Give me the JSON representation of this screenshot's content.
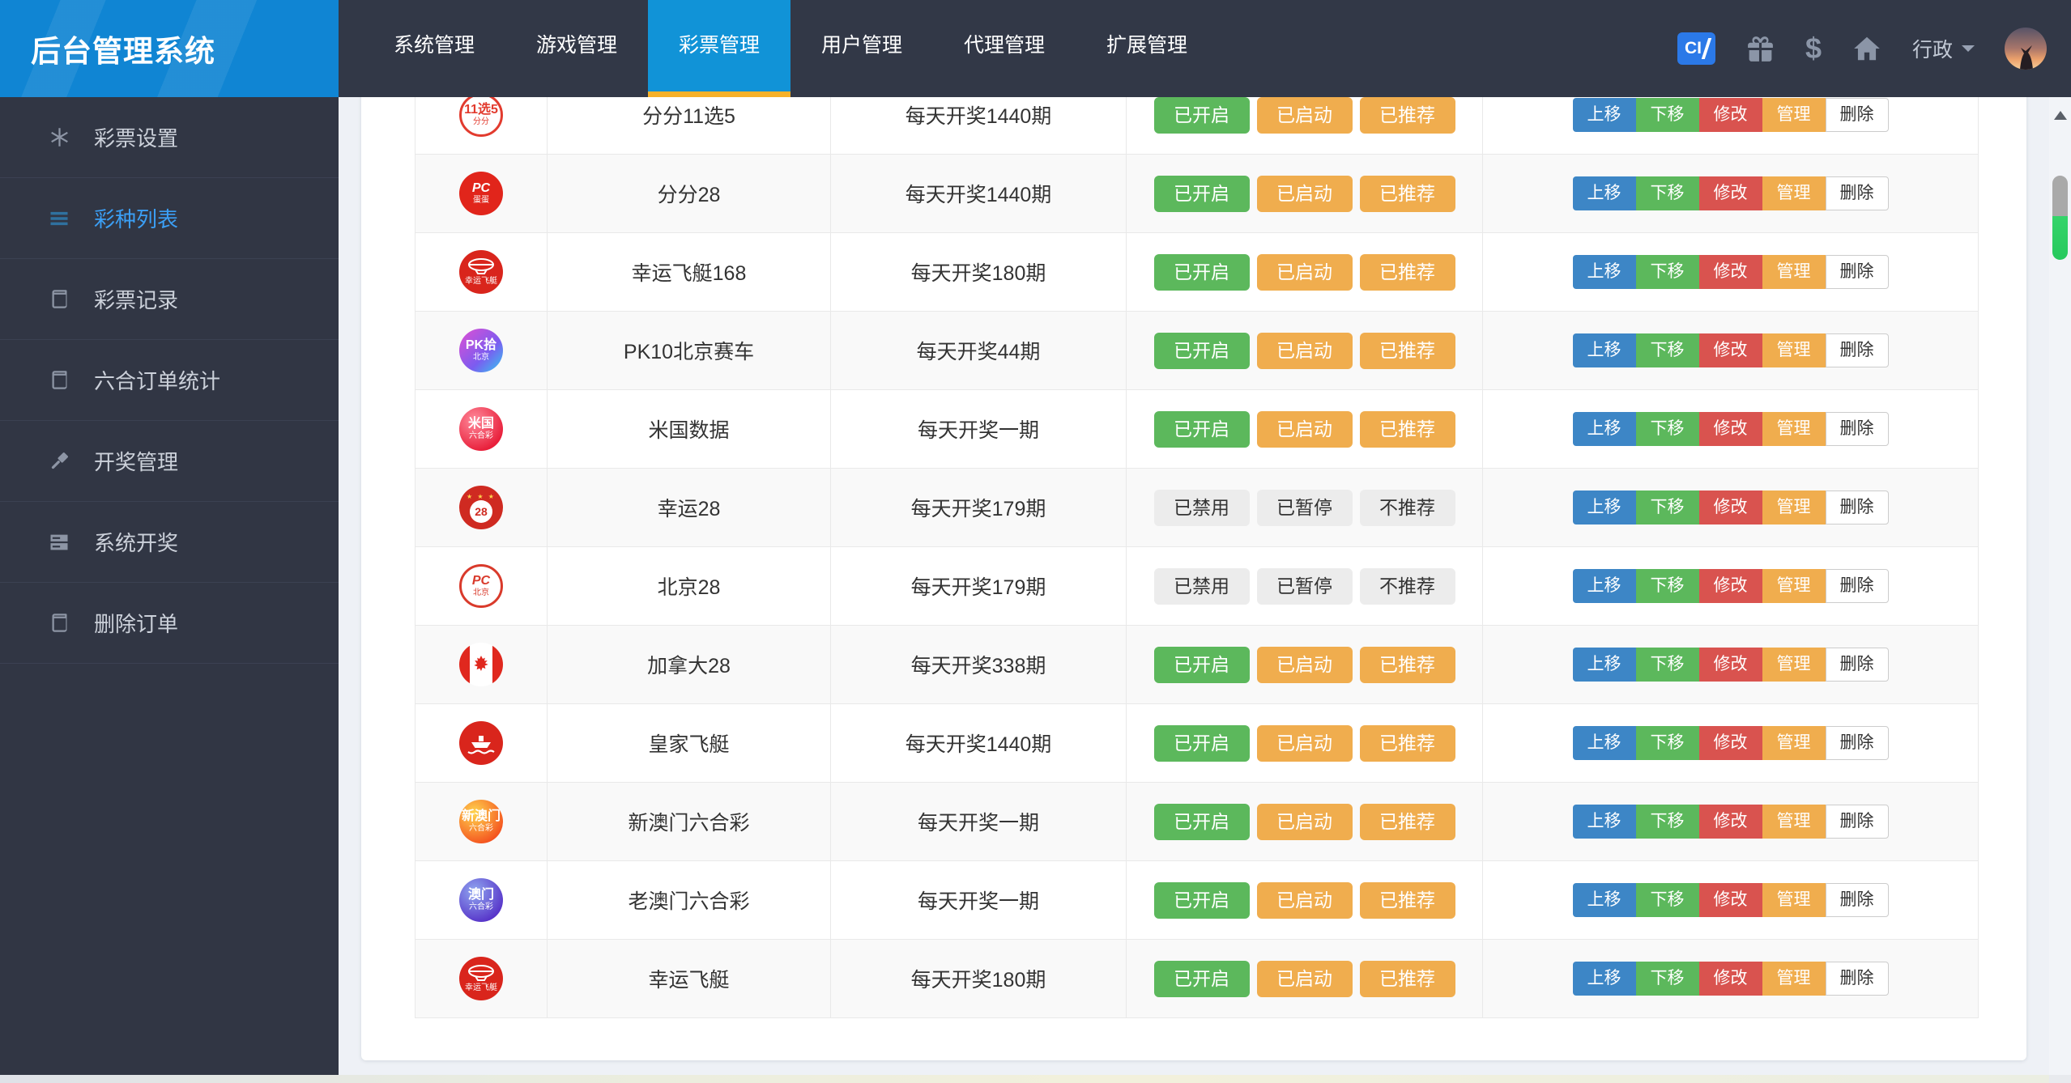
{
  "app": {
    "title": "后台管理系统"
  },
  "nav": {
    "tabs": [
      {
        "label": "系统管理",
        "active": false
      },
      {
        "label": "游戏管理",
        "active": false
      },
      {
        "label": "彩票管理",
        "active": true
      },
      {
        "label": "用户管理",
        "active": false
      },
      {
        "label": "代理管理",
        "active": false
      },
      {
        "label": "扩展管理",
        "active": false
      }
    ],
    "right": {
      "ci_badge": "CI",
      "user_label": "行政"
    }
  },
  "sidebar": {
    "items": [
      {
        "label": "彩票设置",
        "icon": "asterisk-icon",
        "active": false
      },
      {
        "label": "彩种列表",
        "icon": "list-icon",
        "active": true
      },
      {
        "label": "彩票记录",
        "icon": "book-icon",
        "active": false
      },
      {
        "label": "六合订单统计",
        "icon": "book-icon",
        "active": false
      },
      {
        "label": "开奖管理",
        "icon": "gavel-icon",
        "active": false
      },
      {
        "label": "系统开奖",
        "icon": "server-icon",
        "active": false
      },
      {
        "label": "删除订单",
        "icon": "book-icon",
        "active": false
      }
    ]
  },
  "table": {
    "status_enabled": [
      "已开启",
      "已启动",
      "已推荐"
    ],
    "status_disabled": [
      "已禁用",
      "已暂停",
      "不推荐"
    ],
    "actions": [
      "上移",
      "下移",
      "修改",
      "管理",
      "删除"
    ],
    "rows": [
      {
        "name": "分分11选5",
        "frequency": "每天开奖1440期",
        "enabled": true,
        "icon": {
          "kind": "text",
          "bg": "#ffffff",
          "border": "3px solid #e23b2e",
          "color": "#e23b2e",
          "line1": "11选5",
          "line2": "分分"
        }
      },
      {
        "name": "分分28",
        "frequency": "每天开奖1440期",
        "enabled": true,
        "icon": {
          "kind": "text",
          "bg": "#e1251b",
          "color": "#ffffff",
          "line1": "PC",
          "line2": "蛋蛋",
          "italic": true
        }
      },
      {
        "name": "幸运飞艇168",
        "frequency": "每天开奖180期",
        "enabled": true,
        "icon": {
          "kind": "airship",
          "bg": "#d9251c",
          "color": "#ffffff",
          "label": "幸运飞艇"
        }
      },
      {
        "name": "PK10北京赛车",
        "frequency": "每天开奖44期",
        "enabled": true,
        "icon": {
          "kind": "text",
          "bg": "linear-gradient(135deg,#e14fd3,#7b5cf0 60%,#33c9f0)",
          "color": "#ffffff",
          "line1": "PK拾",
          "line2": "北京"
        }
      },
      {
        "name": "米国数据",
        "frequency": "每天开奖一期",
        "enabled": true,
        "icon": {
          "kind": "text",
          "bg": "radial-gradient(circle at 35% 30%,#ff8a9b,#e81f3a 75%)",
          "color": "#ffffff",
          "line1": "米国",
          "line2": "六合彩"
        }
      },
      {
        "name": "幸运28",
        "frequency": "每天开奖179期",
        "enabled": false,
        "icon": {
          "kind": "ball28",
          "bg": "#cf2a21",
          "ball": "28",
          "stars": "★ ★ ★"
        }
      },
      {
        "name": "北京28",
        "frequency": "每天开奖179期",
        "enabled": false,
        "icon": {
          "kind": "text",
          "bg": "#ffffff",
          "border": "3px solid #d93a2b",
          "color": "#d93a2b",
          "line1": "PC",
          "line2": "北京",
          "italic": true
        }
      },
      {
        "name": "加拿大28",
        "frequency": "每天开奖338期",
        "enabled": true,
        "icon": {
          "kind": "canada"
        }
      },
      {
        "name": "皇家飞艇",
        "frequency": "每天开奖1440期",
        "enabled": true,
        "icon": {
          "kind": "boat",
          "bg": "#d9251c"
        }
      },
      {
        "name": "新澳门六合彩",
        "frequency": "每天开奖一期",
        "enabled": true,
        "icon": {
          "kind": "text",
          "bg": "radial-gradient(circle at 35% 30%,#ffd54f,#f4511e 78%)",
          "color": "#ffffff",
          "line1": "新澳门",
          "line2": "六合彩"
        }
      },
      {
        "name": "老澳门六合彩",
        "frequency": "每天开奖一期",
        "enabled": true,
        "icon": {
          "kind": "text",
          "bg": "radial-gradient(circle at 35% 30%,#90a7f0,#5632c8 78%)",
          "color": "#ffffff",
          "line1": "澳门",
          "line2": "六合彩"
        }
      },
      {
        "name": "幸运飞艇",
        "frequency": "每天开奖180期",
        "enabled": true,
        "icon": {
          "kind": "airship",
          "bg": "#d9251c",
          "color": "#ffffff",
          "label": "幸运飞艇"
        }
      }
    ]
  },
  "colors": {
    "nav_bg": "#323847",
    "logo_blue": "#1085d3",
    "active_tab_blue": "#1193d7",
    "active_tab_underline": "#f7b129",
    "sidebar_active_text": "#3b9ff5",
    "green": "#5cb85c",
    "orange": "#f0ad4e",
    "red": "#d9534f",
    "move_up_blue": "#3d86c6",
    "scroll_thumb_green": "#35d46a"
  }
}
